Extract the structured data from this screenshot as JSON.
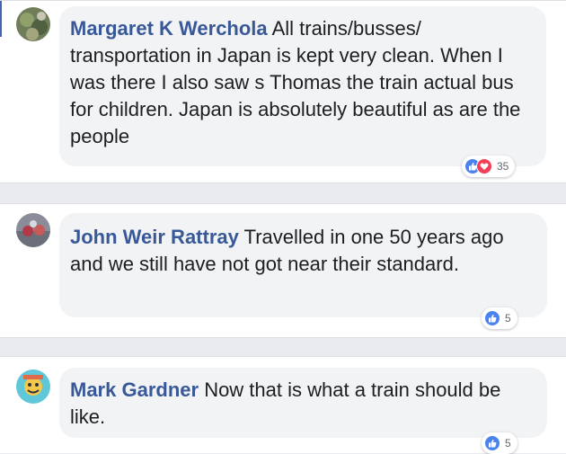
{
  "comments": [
    {
      "author": "Margaret K Werchola",
      "text": "All trains/busses/ transportation in Japan is kept very clean. When I was there I also saw s Thomas the train actual bus for children. Japan is absolutely beautiful as are the people",
      "reaction_count": "35",
      "reaction_icons": [
        "like-icon",
        "love-icon"
      ]
    },
    {
      "author": "John Weir Rattray",
      "text": "Travelled in one 50 years ago and we still have not got near their standard.",
      "reaction_count": "5",
      "reaction_icons": [
        "like-icon"
      ]
    },
    {
      "author": "Mark Gardner",
      "text": "Now that is what a train should be like.",
      "reaction_count": "5",
      "reaction_icons": [
        "like-icon"
      ]
    }
  ],
  "colors": {
    "name": "#385898",
    "bubble": "#f2f3f5",
    "like": "#4a83f0",
    "love": "#f33e58"
  }
}
